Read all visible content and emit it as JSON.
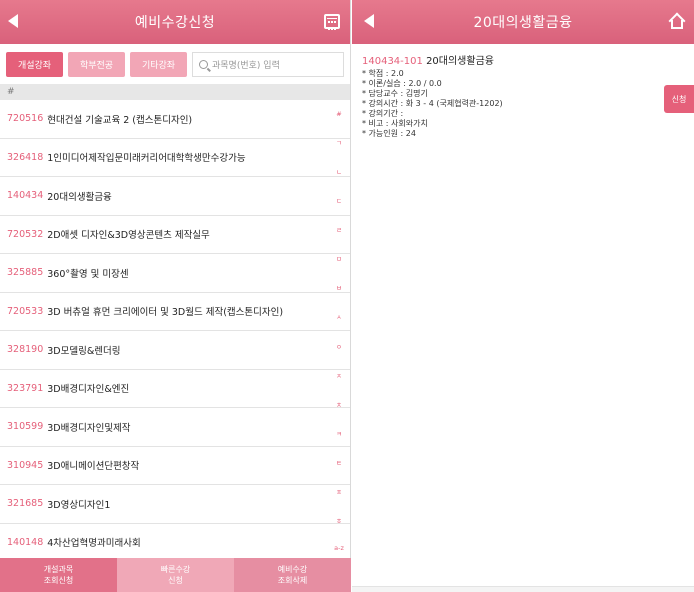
{
  "left": {
    "header": {
      "title": "예비수강신청",
      "back_icon": "back-arrow-icon",
      "calendar_icon": "calendar-icon"
    },
    "tabs": [
      {
        "label": "개설강좌",
        "active": true
      },
      {
        "label": "학부전공",
        "active": false
      },
      {
        "label": "기타강좌",
        "active": false
      }
    ],
    "search": {
      "placeholder": "과목명(번호) 입력",
      "icon": "search-icon"
    },
    "section_header": "#",
    "courses": [
      {
        "code": "720516",
        "name": "현대건설 기술교육 2 (캡스톤디자인)"
      },
      {
        "code": "326418",
        "name": "1인미디어제작입문미래커리어대학학생만수강가능"
      },
      {
        "code": "140434",
        "name": "20대의생활금융"
      },
      {
        "code": "720532",
        "name": "2D애셋 디자인&3D영상콘텐츠 제작실무"
      },
      {
        "code": "325885",
        "name": "360°촬영 및 미장센"
      },
      {
        "code": "720533",
        "name": "3D 버츄얼 휴먼 크리에이터 및 3D월드 제작(캡스톤디자인)"
      },
      {
        "code": "328190",
        "name": "3D모델링&렌더링"
      },
      {
        "code": "323791",
        "name": "3D배경디자인&엔진"
      },
      {
        "code": "310599",
        "name": "3D배경디자인및제작"
      },
      {
        "code": "310945",
        "name": "3D애니메이션단편창작"
      },
      {
        "code": "321685",
        "name": "3D영상디자인1"
      },
      {
        "code": "140148",
        "name": "4차산업혁명과미래사회"
      }
    ],
    "index_letters": [
      "#",
      "ㄱ",
      "ㄴ",
      "ㄷ",
      "ㄹ",
      "ㅁ",
      "ㅂ",
      "ㅅ",
      "ㅇ",
      "ㅈ",
      "ㅊ",
      "ㅋ",
      "ㅌ",
      "ㅍ",
      "ㅎ",
      "a-z"
    ],
    "bottom_tabs": [
      {
        "line1": "개설과목",
        "line2": "조회신청",
        "state": "active"
      },
      {
        "line1": "빠른수강",
        "line2": "신청",
        "state": "inactive"
      },
      {
        "line1": "예비수강",
        "line2": "조회삭제",
        "state": "dark"
      }
    ]
  },
  "right": {
    "header": {
      "title": "20대의생활금융",
      "back_icon": "back-arrow-icon",
      "home_icon": "home-icon"
    },
    "detail": {
      "code": "140434-101",
      "name": "20대의생활금융",
      "lines": [
        "* 학점 : 2.0",
        "* 이론/실습 : 2.0 / 0.0",
        "* 담당교수 : 김명기",
        "* 강의시간 : 화 3 - 4 (국제협력관-1202)",
        "* 강의기간 :",
        "* 비고 : 사회와가치",
        "* 가능인원 : 24"
      ]
    },
    "apply_label": "신청"
  },
  "colors": {
    "accent": "#e5607a",
    "accent_light": "#f2a6b6",
    "header": "#d9617b"
  }
}
